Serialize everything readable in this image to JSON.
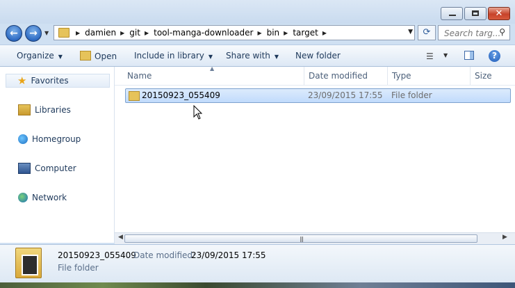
{
  "window": {
    "minimize_icon": "minimize-icon",
    "maximize_icon": "maximize-icon",
    "close_icon": "close-icon",
    "close_glyph": "✕"
  },
  "address": {
    "back_glyph": "←",
    "forward_glyph": "→",
    "crumbs": [
      "damien",
      "git",
      "tool-manga-downloader",
      "bin",
      "target"
    ],
    "refresh_glyph": "⟳",
    "search_placeholder": "Search targ..."
  },
  "toolbar": {
    "organize": "Organize",
    "open": "Open",
    "include_in_library": "Include in library",
    "share_with": "Share with",
    "new_folder": "New folder"
  },
  "sidebar": {
    "items": [
      {
        "label": "Favorites",
        "icon": "star-icon"
      },
      {
        "label": "Libraries",
        "icon": "libraries-icon"
      },
      {
        "label": "Homegroup",
        "icon": "homegroup-icon"
      },
      {
        "label": "Computer",
        "icon": "computer-icon"
      },
      {
        "label": "Network",
        "icon": "network-icon"
      }
    ]
  },
  "columns": {
    "name": "Name",
    "date_modified": "Date modified",
    "type": "Type",
    "size": "Size"
  },
  "files": [
    {
      "name": "20150923_055409",
      "date_modified": "23/09/2015 17:55",
      "type": "File folder",
      "size": "",
      "selected": true
    }
  ],
  "details": {
    "name": "20150923_055409",
    "date_label": "Date modified:",
    "date_value": "23/09/2015 17:55",
    "type": "File folder"
  },
  "colors": {
    "selection": "#c1dbfc",
    "chrome": "#cfe0f2",
    "close_button": "#c7432a"
  }
}
